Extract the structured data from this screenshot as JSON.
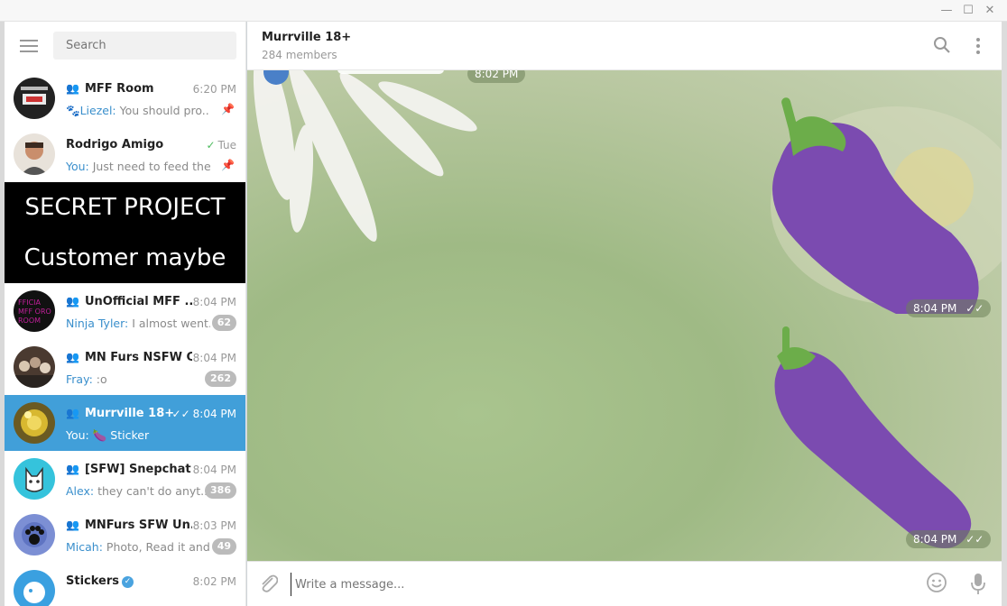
{
  "window": {
    "minimize": "—",
    "maximize": "☐",
    "close": "✕"
  },
  "sidebar": {
    "search_placeholder": "Search",
    "chats": [
      {
        "title": "MFF Room",
        "time": "6:20 PM",
        "sender": "Liezel:",
        "preview": " You should pro...",
        "pinned": true
      },
      {
        "title": "Rodrigo Amigo",
        "time": "Tue",
        "ticks": "✓",
        "sender": "You:",
        "preview": " Just need to feed the...",
        "pinned": true
      },
      {
        "title": "UnOfficial MFF ...",
        "time": "8:04 PM",
        "sender": "Ninja Tyler:",
        "preview": " I almost went...",
        "badge": "62"
      },
      {
        "title": "MN Furs NSFW C...",
        "time": "8:04 PM",
        "sender": "Fray:",
        "preview": " :o",
        "badge": "262"
      },
      {
        "title": "Murrville 18+",
        "time": "8:04 PM",
        "ticks": "✓✓",
        "sender": "You:",
        "preview": " 🍆 Sticker"
      },
      {
        "title": "[SFW] Snepchat +...",
        "time": "8:04 PM",
        "sender": "Alex:",
        "preview": " they can't do anyt...",
        "badge": "386"
      },
      {
        "title": "MNFurs SFW Un...",
        "time": "8:03 PM",
        "sender": "Micah:",
        "preview": " Photo, Read it and...",
        "badge": "49"
      },
      {
        "title": "Stickers",
        "time": "8:02 PM",
        "verified": "✓"
      }
    ],
    "banner": {
      "line1": "SECRET PROJECT",
      "line2": "Customer maybe"
    }
  },
  "chat": {
    "title": "Murrville 18+",
    "subtitle": "284 members",
    "messages": [
      {
        "time": "8:02 PM",
        "type": "sticker"
      },
      {
        "time": "8:04 PM",
        "ticks": "✓✓",
        "type": "sticker",
        "sticker": "eggplant"
      },
      {
        "time": "8:04 PM",
        "ticks": "✓✓",
        "type": "sticker",
        "sticker": "eggplant"
      }
    ],
    "composer_placeholder": "Write a message..."
  },
  "icons": {
    "menu": "hamburger-icon",
    "search": "search-icon",
    "more": "more-vertical-icon",
    "attach": "paperclip-icon",
    "emoji": "emoji-icon",
    "mic": "microphone-icon"
  },
  "colors": {
    "accent": "#419fd9",
    "badge": "#bbbbbb",
    "eggplant": "#7b4bb0",
    "stem": "#6cad4a"
  }
}
